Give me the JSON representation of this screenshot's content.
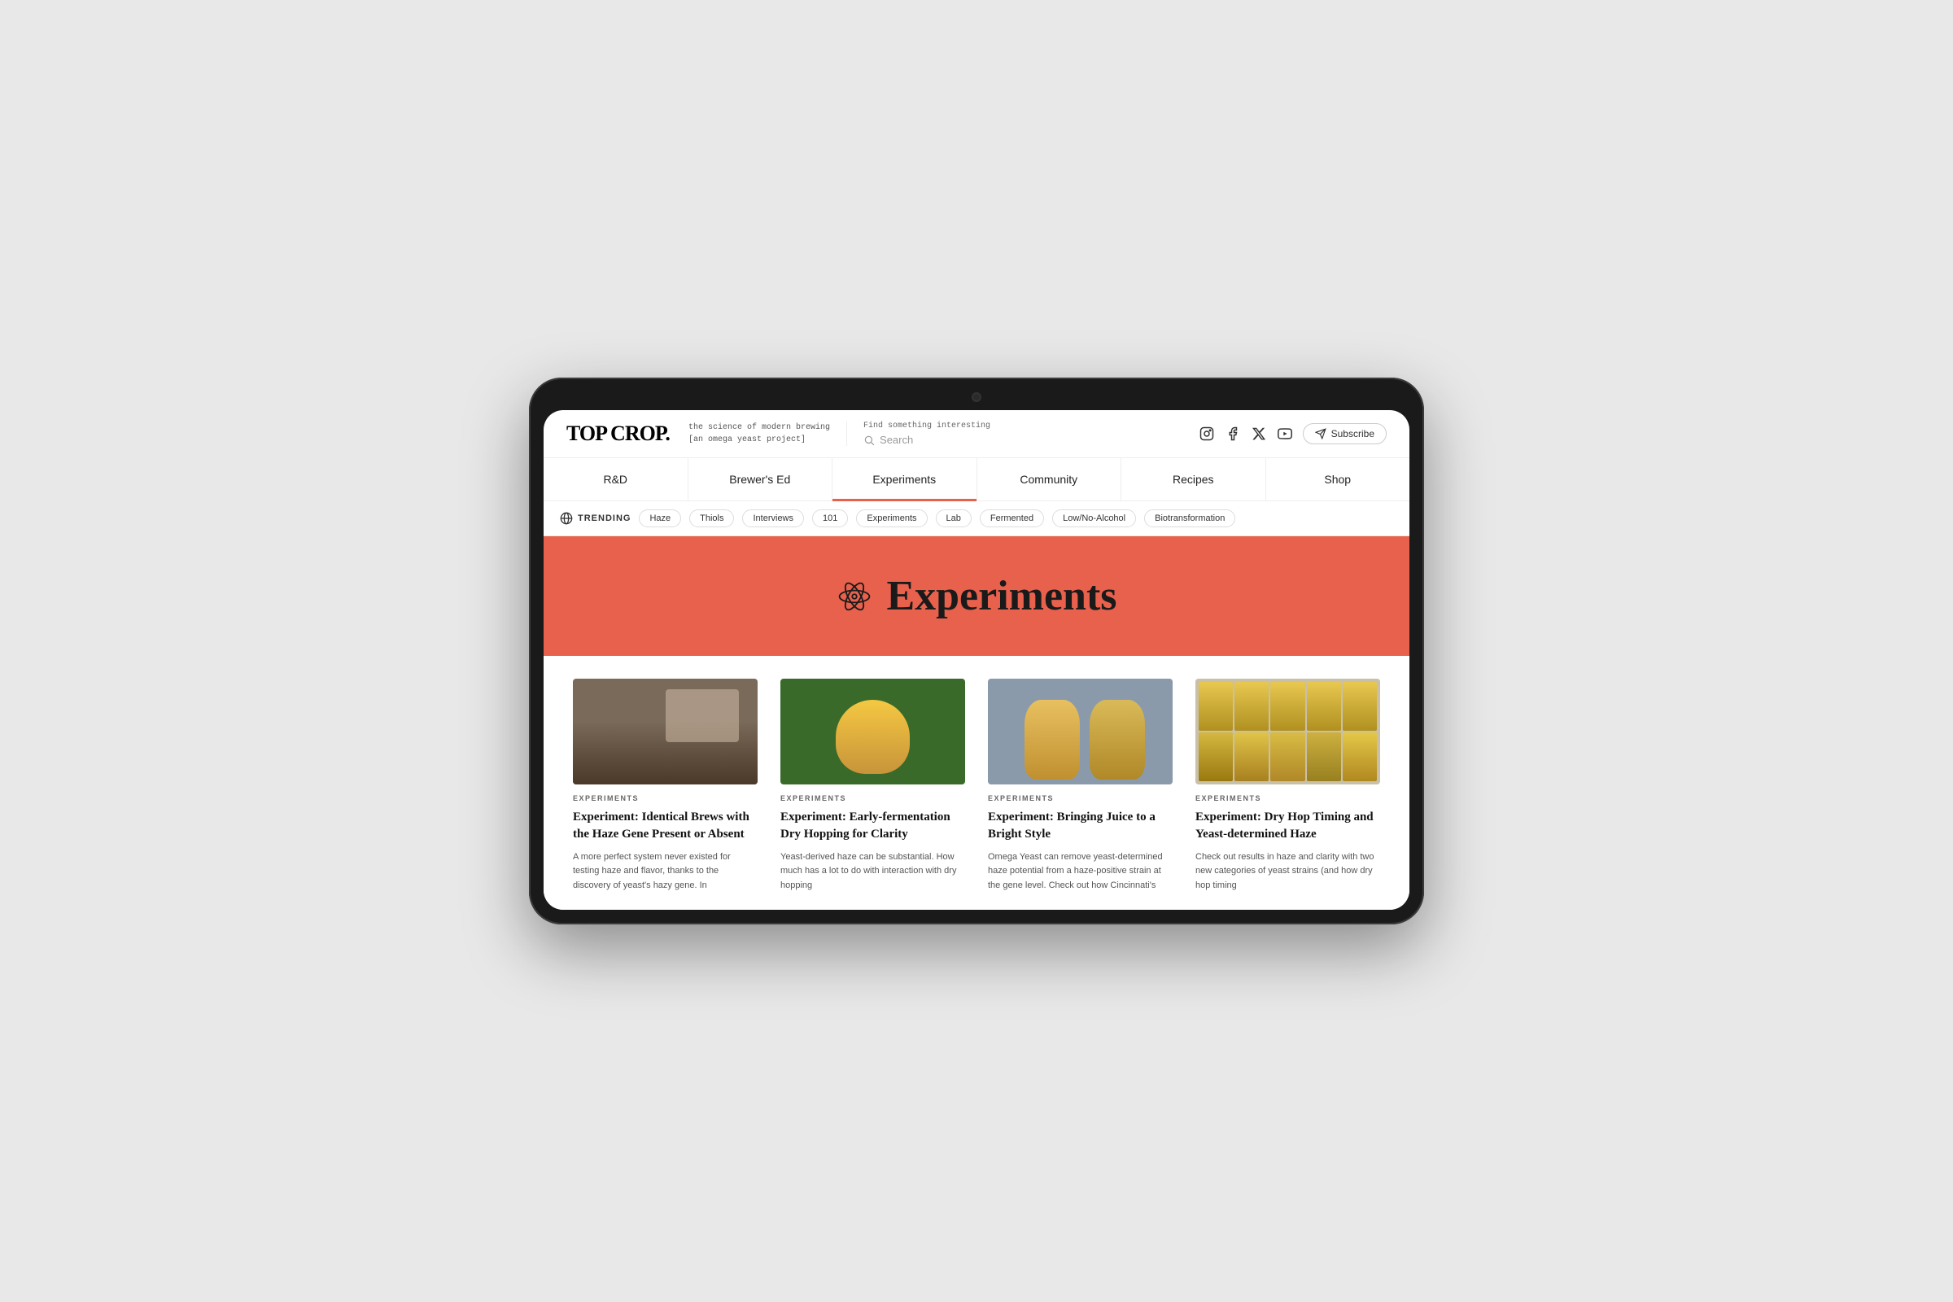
{
  "device": {
    "camera_alt": "front camera"
  },
  "header": {
    "logo": "TOP CROP.",
    "tagline_line1": "the science of modern brewing",
    "tagline_line2": "[an omega yeast project]",
    "search_label": "Find something interesting",
    "search_placeholder": "Search",
    "social": {
      "instagram": "IG",
      "facebook": "f",
      "twitter": "𝕏",
      "youtube": "▶"
    },
    "subscribe_label": "Subscribe"
  },
  "nav": {
    "items": [
      {
        "label": "R&D",
        "active": false
      },
      {
        "label": "Brewer's Ed",
        "active": false
      },
      {
        "label": "Experiments",
        "active": true
      },
      {
        "label": "Community",
        "active": false
      },
      {
        "label": "Recipes",
        "active": false
      },
      {
        "label": "Shop",
        "active": false
      }
    ]
  },
  "trending": {
    "label": "TRENDING",
    "tags": [
      "Haze",
      "Thiols",
      "Interviews",
      "101",
      "Experiments",
      "Lab",
      "Fermented",
      "Low/No-Alcohol",
      "Biotransformation"
    ]
  },
  "hero": {
    "title": "Experiments",
    "icon_alt": "atom icon"
  },
  "articles": [
    {
      "category": "EXPERIMENTS",
      "title": "Experiment: Identical Brews with the Haze Gene Present or Absent",
      "excerpt": "A more perfect system never existed for testing haze and flavor, thanks to the discovery of yeast's hazy gene. In"
    },
    {
      "category": "EXPERIMENTS",
      "title": "Experiment: Early-fermentation Dry Hopping for Clarity",
      "excerpt": "Yeast-derived haze can be substantial. How much has a lot to do with interaction with dry hopping"
    },
    {
      "category": "EXPERIMENTS",
      "title": "Experiment: Bringing Juice to a Bright Style",
      "excerpt": "Omega Yeast can remove yeast-determined haze potential from a haze-positive strain at the gene level. Check out how Cincinnati's"
    },
    {
      "category": "EXPERIMENTS",
      "title": "Experiment: Dry Hop Timing and Yeast-determined Haze",
      "excerpt": "Check out results in haze and clarity with two new categories of yeast strains (and how dry hop timing"
    }
  ]
}
